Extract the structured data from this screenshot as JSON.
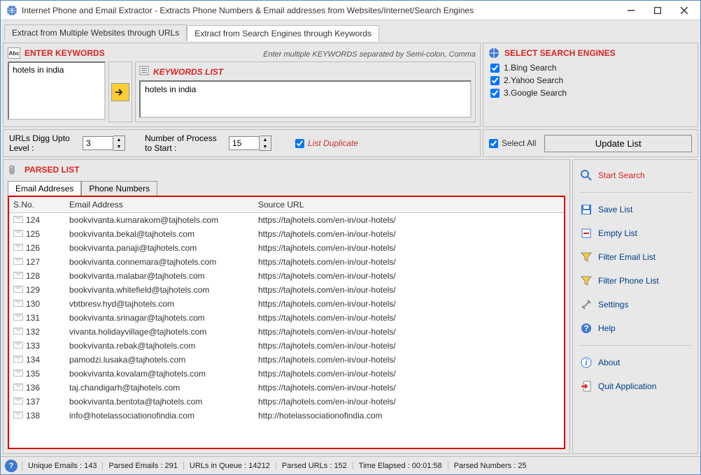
{
  "window": {
    "title": "Internet Phone and Email Extractor - Extracts Phone Numbers & Email addresses from Websites/Internet/Search Engines"
  },
  "tabs": {
    "main": [
      {
        "label": "Extract from Multiple Websites through URLs",
        "active": false
      },
      {
        "label": "Extract from Search Engines through Keywords",
        "active": true
      }
    ]
  },
  "keywords": {
    "title": "ENTER KEYWORDS",
    "hint": "Enter multiple KEYWORDS separated by Semi-colon, Comma",
    "input_value": "hotels in india",
    "list_title": "KEYWORDS LIST",
    "items": [
      "hotels in india"
    ]
  },
  "engines": {
    "title": "SELECT SEARCH ENGINES",
    "items": [
      {
        "label": "1.Bing Search",
        "checked": true
      },
      {
        "label": "2.Yahoo Search",
        "checked": true
      },
      {
        "label": "3.Google Search",
        "checked": true
      }
    ],
    "select_all": {
      "label": "Select All",
      "checked": true
    },
    "update_btn": "Update List"
  },
  "options": {
    "digg_label": "URLs Digg Upto Level :",
    "digg_value": "3",
    "process_label": "Number of Process to Start :",
    "process_value": "15",
    "list_dup_label": "List Duplicate",
    "list_dup_checked": true
  },
  "parsed": {
    "title": "PARSED LIST",
    "tabs": [
      {
        "label": "Email Addreses",
        "active": true
      },
      {
        "label": "Phone Numbers",
        "active": false
      }
    ],
    "columns": {
      "sno": "S.No.",
      "email": "Email Address",
      "url": "Source URL"
    },
    "rows": [
      {
        "sno": "124",
        "email": "bookvivanta.kumarakom@tajhotels.com",
        "url": "https://tajhotels.com/en-in/our-hotels/"
      },
      {
        "sno": "125",
        "email": "bookvivanta.bekal@tajhotels.com",
        "url": "https://tajhotels.com/en-in/our-hotels/"
      },
      {
        "sno": "126",
        "email": "bookvivanta.panaji@tajhotels.com",
        "url": "https://tajhotels.com/en-in/our-hotels/"
      },
      {
        "sno": "127",
        "email": "bookvivanta.connemara@tajhotels.com",
        "url": "https://tajhotels.com/en-in/our-hotels/"
      },
      {
        "sno": "128",
        "email": "bookvivanta.malabar@tajhotels.com",
        "url": "https://tajhotels.com/en-in/our-hotels/"
      },
      {
        "sno": "129",
        "email": "bookvivanta.whitefield@tajhotels.com",
        "url": "https://tajhotels.com/en-in/our-hotels/"
      },
      {
        "sno": "130",
        "email": "vbtbresv.hyd@tajhotels.com",
        "url": "https://tajhotels.com/en-in/our-hotels/"
      },
      {
        "sno": "131",
        "email": "bookvivanta.srinagar@tajhotels.com",
        "url": "https://tajhotels.com/en-in/our-hotels/"
      },
      {
        "sno": "132",
        "email": "vivanta.holidayvillage@tajhotels.com",
        "url": "https://tajhotels.com/en-in/our-hotels/"
      },
      {
        "sno": "133",
        "email": "bookvivanta.rebak@tajhotels.com",
        "url": "https://tajhotels.com/en-in/our-hotels/"
      },
      {
        "sno": "134",
        "email": "pamodzi.lusaka@tajhotels.com",
        "url": "https://tajhotels.com/en-in/our-hotels/"
      },
      {
        "sno": "135",
        "email": "bookvivanta.kovalam@tajhotels.com",
        "url": "https://tajhotels.com/en-in/our-hotels/"
      },
      {
        "sno": "136",
        "email": "taj.chandigarh@tajhotels.com",
        "url": "https://tajhotels.com/en-in/our-hotels/"
      },
      {
        "sno": "137",
        "email": "bookvivanta.bentota@tajhotels.com",
        "url": "https://tajhotels.com/en-in/our-hotels/"
      },
      {
        "sno": "138",
        "email": "info@hotelassociationofindia.com",
        "url": "http://hotelassociationofindia.com"
      }
    ]
  },
  "side": {
    "start": "Start Search",
    "save": "Save List",
    "empty": "Empty List",
    "filter_email": "Filter Email List",
    "filter_phone": "Filter Phone List",
    "settings": "Settings",
    "help": "Help",
    "about": "About",
    "quit": "Quit Application"
  },
  "status": {
    "unique": "Unique Emails :  143",
    "parsed_e": "Parsed Emails :   291",
    "queue": "URLs in Queue :  14212",
    "parsed_u": "Parsed URLs :   152",
    "time": "Time Elapsed :   00:01:58",
    "parsed_n": "Parsed Numbers :   25"
  }
}
